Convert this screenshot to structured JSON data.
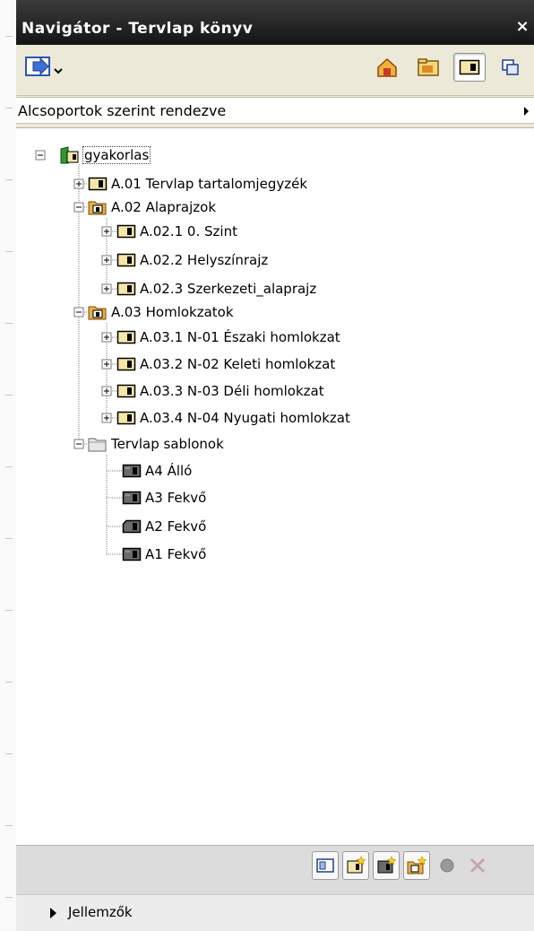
{
  "window": {
    "title": "Navigátor - Tervlap könyv",
    "close_label": "×"
  },
  "toolbar": {
    "buttons": [
      {
        "name": "publish-menu-icon"
      },
      {
        "name": "project-map-icon"
      },
      {
        "name": "view-map-icon"
      },
      {
        "name": "layout-book-icon",
        "pressed": true
      },
      {
        "name": "publisher-sets-icon"
      }
    ]
  },
  "sort": {
    "label": "Alcsoportok szerint rendezve"
  },
  "tree": {
    "items": [
      {
        "label": "gyakorlas",
        "icon": "book-icon",
        "selected": true
      },
      {
        "label": "A.01 Tervlap tartalomjegyzék",
        "icon": "layout-icon"
      },
      {
        "label": "A.02 Alaprajzok",
        "icon": "subset-folder-icon"
      },
      {
        "label": "A.02.1 0. Szint",
        "icon": "layout-icon"
      },
      {
        "label": "A.02.2 Helyszínrajz",
        "icon": "layout-icon"
      },
      {
        "label": "A.02.3 Szerkezeti_alaprajz",
        "icon": "layout-icon"
      },
      {
        "label": "A.03 Homlokzatok",
        "icon": "subset-folder-icon"
      },
      {
        "label": "A.03.1 N-01 Északi homlokzat",
        "icon": "layout-icon"
      },
      {
        "label": "A.03.2 N-02 Keleti homlokzat",
        "icon": "layout-icon"
      },
      {
        "label": "A.03.3 N-03 Déli homlokzat",
        "icon": "layout-icon"
      },
      {
        "label": "A.03.4 N-04 Nyugati homlokzat",
        "icon": "layout-icon"
      },
      {
        "label": "Tervlap sablonok",
        "icon": "master-folder-icon"
      },
      {
        "label": "A4 Álló",
        "icon": "master-layout-icon"
      },
      {
        "label": "A3 Fekvő",
        "icon": "master-layout-icon"
      },
      {
        "label": "A2 Fekvő",
        "icon": "master-layout-icon"
      },
      {
        "label": "A1 Fekvő",
        "icon": "master-layout-icon"
      }
    ]
  },
  "bottom_toolbar": {
    "buttons": [
      {
        "name": "new-layout-icon"
      },
      {
        "name": "new-subset-icon"
      },
      {
        "name": "new-master-icon"
      },
      {
        "name": "new-folder-icon"
      },
      {
        "name": "record-icon"
      },
      {
        "name": "delete-icon"
      }
    ]
  },
  "properties": {
    "label": "Jellemzők"
  },
  "colors": {
    "titlebar": "#1f1f1f",
    "panel": "#ece9d8",
    "layout_icon": "#f5e7a8",
    "folder_icon": "#e8b14a",
    "master_icon": "#6b6b6b",
    "book_green": "#2f9a2f"
  }
}
